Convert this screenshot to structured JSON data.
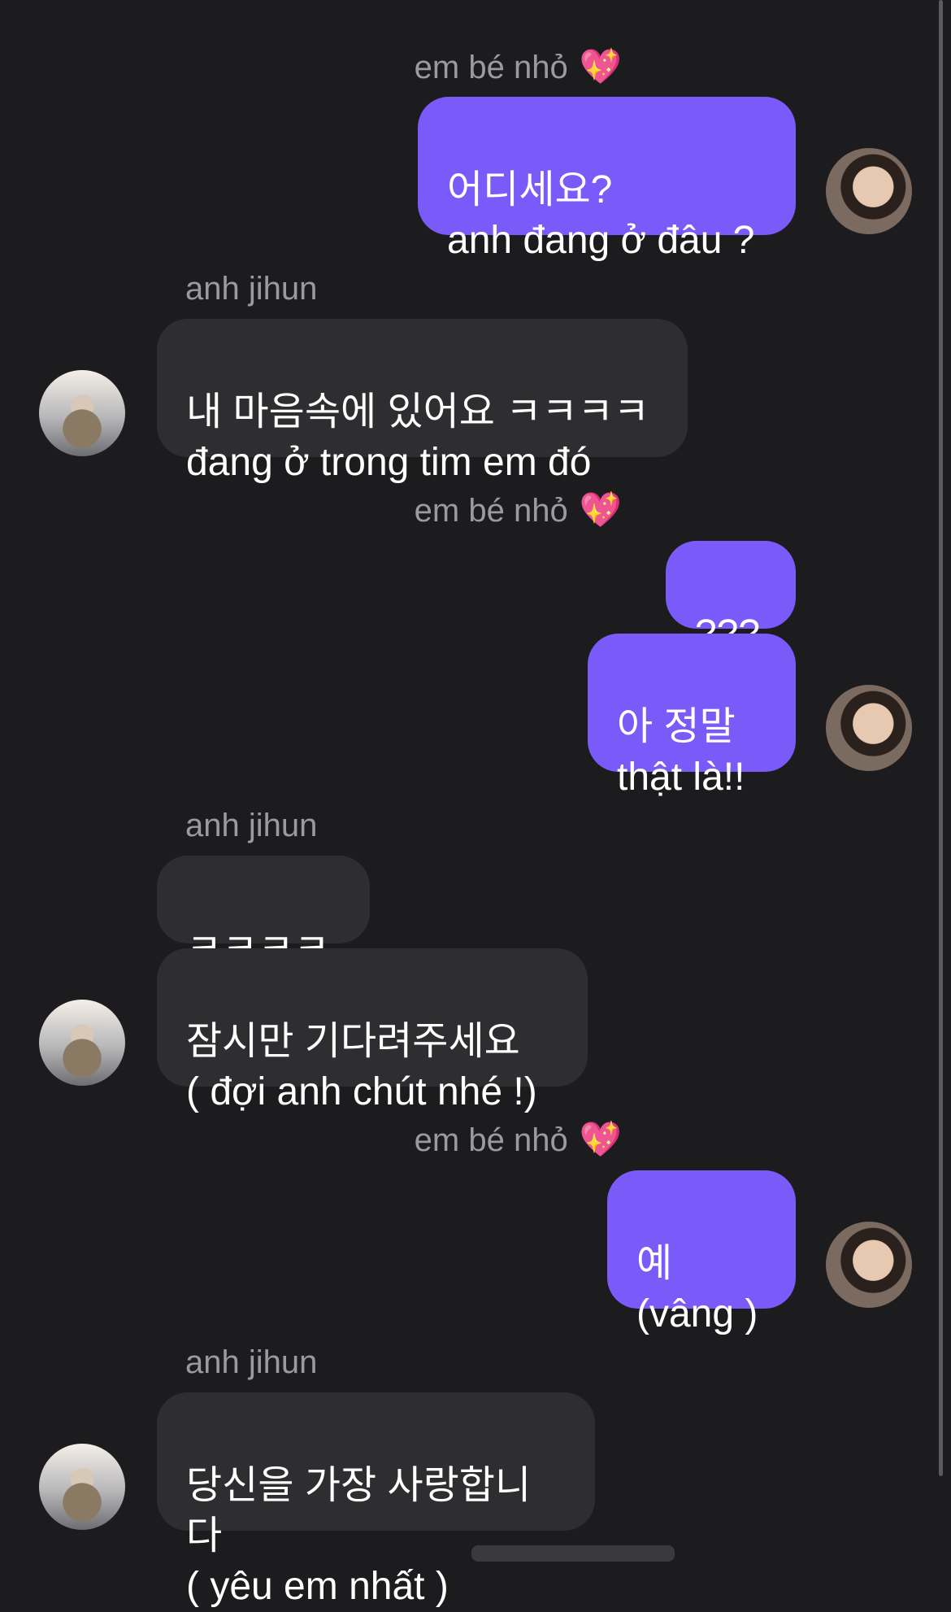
{
  "chat": {
    "me_name": "em bé nhỏ",
    "me_heart": "💖",
    "them_name": "anh jihun",
    "messages": [
      {
        "text": "어디세요?\nanh đang ở đâu ?"
      },
      {
        "text": "내 마음속에 있어요 ㅋㅋㅋㅋ\nđang ở trong tim em đó"
      },
      {
        "text": "???"
      },
      {
        "text": "아 정말\n thật là!!"
      },
      {
        "text": "ㅋㅋㅋㅋ"
      },
      {
        "text": "잠시만 기다려주세요\n( đợi anh chút nhé !)"
      },
      {
        "text": "예\n(vâng )"
      },
      {
        "text": "당신을 가장 사랑합니다\n( yêu em nhất )"
      }
    ]
  },
  "colors": {
    "background": "#1c1c1e",
    "my_bubble": "#7a5af8",
    "their_bubble": "#2e2e31",
    "sender_name": "#9a9aa0"
  }
}
